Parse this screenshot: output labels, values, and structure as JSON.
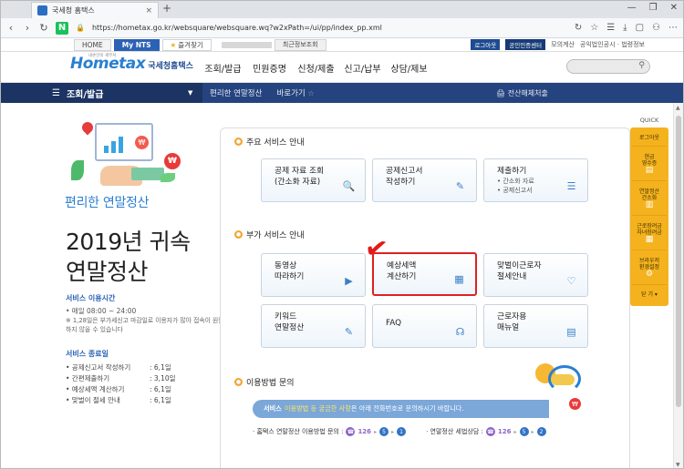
{
  "browser": {
    "tab_title": "국세청 홈택스",
    "close_glyph": "×",
    "new_tab_glyph": "+",
    "controls": [
      "—",
      "❐",
      "✕"
    ],
    "url": "https://hometax.go.kr/websquare/websquare.wq?w2xPath=/ui/pp/index_pp.xml",
    "toolbar_icons": [
      "↻",
      "☆",
      "☰",
      "⤓",
      "▢",
      "⚇",
      "⋯"
    ]
  },
  "topstrip": {
    "home": "HOME",
    "mynts": "My NTS",
    "favorite": "즐겨찾기",
    "history": "최근정보조회",
    "login": "로그아웃",
    "cert": "공인인증센터",
    "links": [
      "모의계산",
      "공익법인공시 · 법령정보"
    ]
  },
  "header": {
    "logo_main": "Hometax",
    "logo_brand": "국세청홈택스",
    "logo_small": "내손안의 세무서",
    "menu": [
      "조회/발급",
      "민원증명",
      "신청/제출",
      "신고/납부",
      "상담/제보"
    ],
    "search_icon": "search-icon"
  },
  "subbar": {
    "menu_icon": "☰",
    "current": "조회/발급",
    "dropdown": "▼",
    "page": "편리한 연말정산",
    "shortcut": "바로가기",
    "shortcut_star": "☆",
    "print": "전산해체처출"
  },
  "left": {
    "sublabel": "편리한 연말정산",
    "title_line1": "2019년 귀속",
    "title_line2": "연말정산",
    "hours_title": "서비스 이용시간",
    "hours": "• 매일 08:00 ~ 24:00",
    "note": "※ 1,28일은 부가세신고 마감일로 이용자가 많아 접속이 원활하지 않을 수 있습니다",
    "close_title": "서비스 종료일",
    "close_items": [
      {
        "name": "• 공제신고서 작성하기",
        "date": ": 6,1일"
      },
      {
        "name": "• 간편제출하기",
        "date": ": 3,10일"
      },
      {
        "name": "• 예상세액 계산하기",
        "date": ": 6,1일"
      },
      {
        "name": "• 맞벌이 절세 안내",
        "date": ": 6,1일"
      }
    ],
    "coin": "₩"
  },
  "panel": {
    "sec1": "주요 서비스 안내",
    "sec2": "부가 서비스 안내",
    "sec3": "이용방법 문의",
    "cards_main": [
      {
        "l1": "공제 자료 조회",
        "l2": "(간소화 자료)",
        "icon": "🔍"
      },
      {
        "l1": "공제신고서",
        "l2": "작성하기",
        "icon": "✎"
      },
      {
        "l1": "제출하기",
        "b1": "• 간소화 자료",
        "b2": "• 공제신고서",
        "icon": "☰"
      }
    ],
    "cards_sub": [
      {
        "l1": "동영상",
        "l2": "따라하기",
        "icon": "▶"
      },
      {
        "l1": "예상세액",
        "l2": "계산하기",
        "icon": "▦"
      },
      {
        "l1": "맞벌이근로자",
        "l2": "절세안내",
        "icon": "♡"
      },
      {
        "l1": "키워드",
        "l2": "연말정산",
        "icon": "✎"
      },
      {
        "l1": "FAQ",
        "l2": "",
        "icon": "☊"
      },
      {
        "l1": "근로자용",
        "l2": "매뉴얼",
        "icon": "▤"
      }
    ],
    "check_mark": "✔",
    "help_prefix": "서비스",
    "help_highlight": "이용방법 등 궁금한 사항",
    "help_suffix": "은 아래 전화번호로 문의하시기 바랍니다.",
    "phone1_label": "· 홈택스 연말정산 이용방법 문의 :",
    "phone2_label": "· 연말정산 세법상담 :",
    "phone_num": "126",
    "phone1_seq": [
      "5",
      "1"
    ],
    "phone2_seq": [
      "5",
      "2"
    ],
    "arrow": "▸",
    "coin": "₩"
  },
  "quick": {
    "title": "QUICK",
    "items": [
      {
        "label": "로그아웃",
        "icon": ""
      },
      {
        "label": "현금\n영수증",
        "icon": "▤"
      },
      {
        "label": "연말정산\n간소화",
        "icon": "▥"
      },
      {
        "label": "근로장려금\n자녀장려금",
        "icon": "▦"
      },
      {
        "label": "브라우저\n환경설정",
        "icon": "⚙"
      }
    ],
    "close": "닫 기 ▾"
  },
  "colors": {
    "accent": "#2b62b5",
    "subbar": "#25437e",
    "quick": "#f4b31e",
    "highlight_border": "#e02020"
  }
}
